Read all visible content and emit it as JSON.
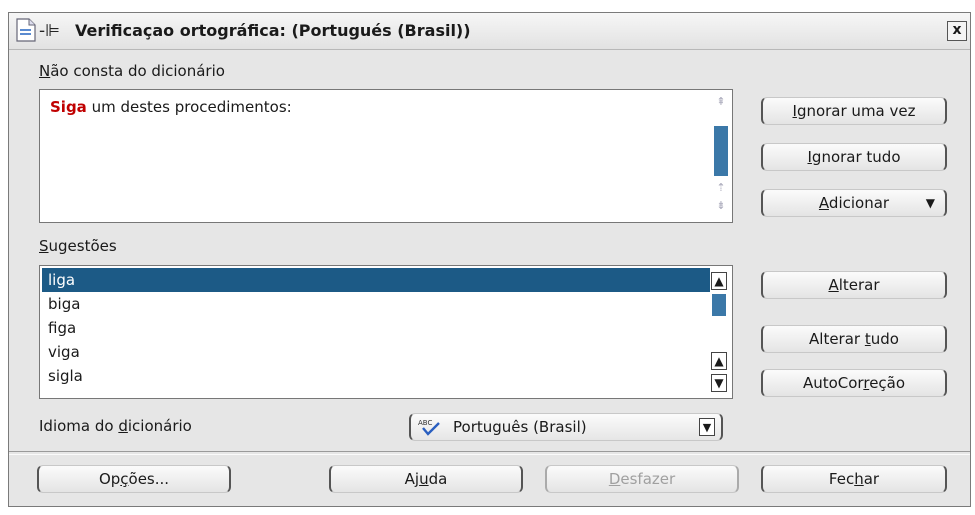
{
  "window": {
    "title": "Verificaçao ortográfica:  (Portugués (Brasil))",
    "close_label": "x"
  },
  "not_in_dictionary": {
    "label_first": "N",
    "label_rest": "ão consta do dicionário",
    "error_word": "Siga",
    "sentence_rest": " um destes procedimentos:"
  },
  "suggestions": {
    "label_first": "S",
    "label_rest": "ugestões",
    "items": [
      "liga",
      "biga",
      "figa",
      "viga",
      "sigla"
    ],
    "selected_index": 0
  },
  "dictionary_language": {
    "label_pre": "Idioma do ",
    "label_u": "d",
    "label_post": "icionário",
    "value": "Português (Brasil)"
  },
  "buttons": {
    "ignore_once": {
      "u": "I",
      "rest": "gnorar uma vez"
    },
    "ignore_all": {
      "pre": "",
      "u": "I",
      "rest": "gnorar tudo"
    },
    "add": {
      "u": "A",
      "rest": "dicionar"
    },
    "change": {
      "u": "A",
      "rest": "lterar"
    },
    "change_all": {
      "pre": "Alterar ",
      "u": "t",
      "rest": "udo"
    },
    "autocorrect": {
      "pre": "AutoCor",
      "u": "r",
      "rest": "eção"
    },
    "options": {
      "pre": "Op",
      "u": "ç",
      "rest": "ões..."
    },
    "help": {
      "pre": "Aj",
      "u": "u",
      "rest": "da"
    },
    "undo": {
      "pre": "",
      "u": "D",
      "rest": "esfazer"
    },
    "close": {
      "pre": "Fec",
      "u": "h",
      "rest": "ar"
    }
  },
  "icons": {
    "window": "document-icon",
    "pin": "pin-icon",
    "language": "abc-spellcheck-icon"
  },
  "colors": {
    "error_word": "#c00000",
    "selection": "#1c5a86",
    "scroll_thumb": "#3b78a8"
  }
}
